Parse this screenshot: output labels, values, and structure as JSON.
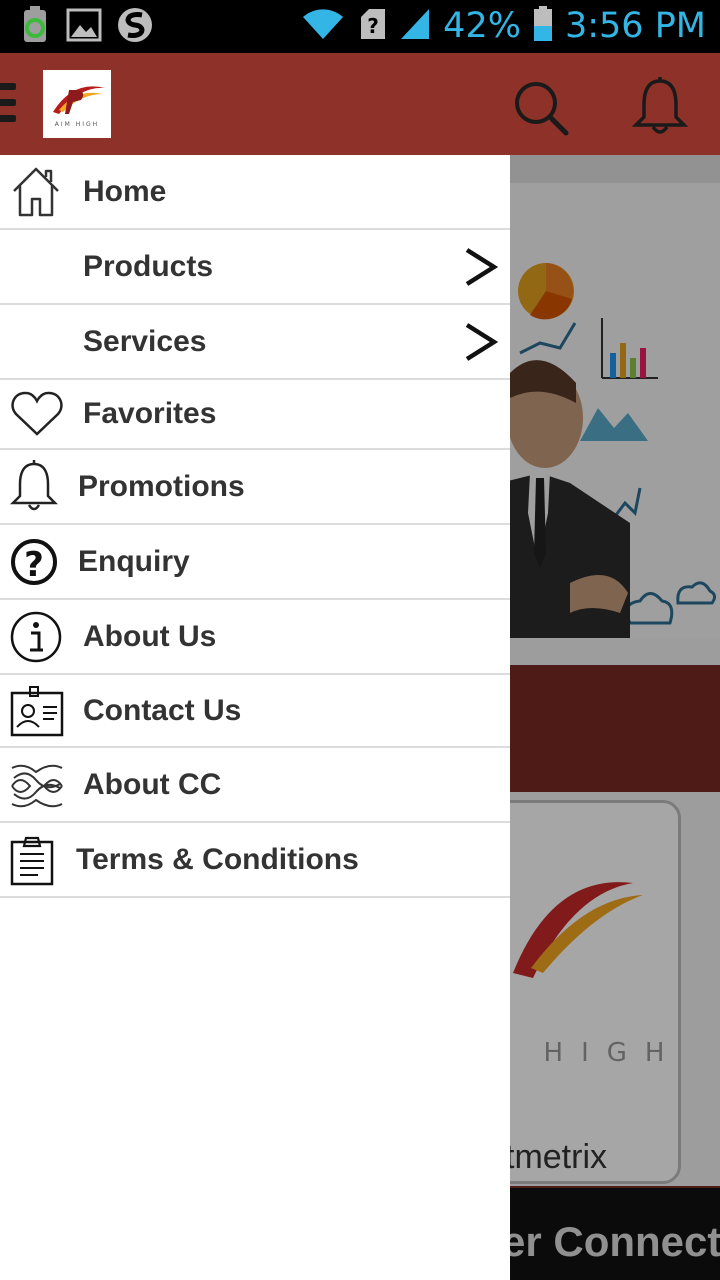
{
  "status_bar": {
    "icons_left": [
      "battery-saver-icon",
      "gallery-icon",
      "sync-icon"
    ],
    "battery_percent": "42%",
    "time": "3:56 PM",
    "icons_right": [
      "wifi-icon",
      "sim-unknown-icon",
      "signal-icon",
      "battery-icon"
    ]
  },
  "app_bar": {
    "logo_text": "AIM HIGH",
    "color": "#8e3128"
  },
  "drawer": {
    "items": [
      {
        "label": "Home",
        "icon": "home-icon"
      },
      {
        "label": "Products",
        "icon": "",
        "has_submenu": true
      },
      {
        "label": "Services",
        "icon": "",
        "has_submenu": true
      },
      {
        "label": "Favorites",
        "icon": "heart-icon"
      },
      {
        "label": "Promotions",
        "icon": "bell-icon"
      },
      {
        "label": "Enquiry",
        "icon": "question-icon"
      },
      {
        "label": "About Us",
        "icon": "info-icon"
      },
      {
        "label": "Contact Us",
        "icon": "contact-card-icon"
      },
      {
        "label": "About CC",
        "icon": "cc-logo-icon"
      },
      {
        "label": "Terms & Conditions",
        "icon": "clipboard-icon"
      }
    ]
  },
  "background": {
    "card_text": "tmetrix",
    "bottom_text": "er Connect"
  }
}
